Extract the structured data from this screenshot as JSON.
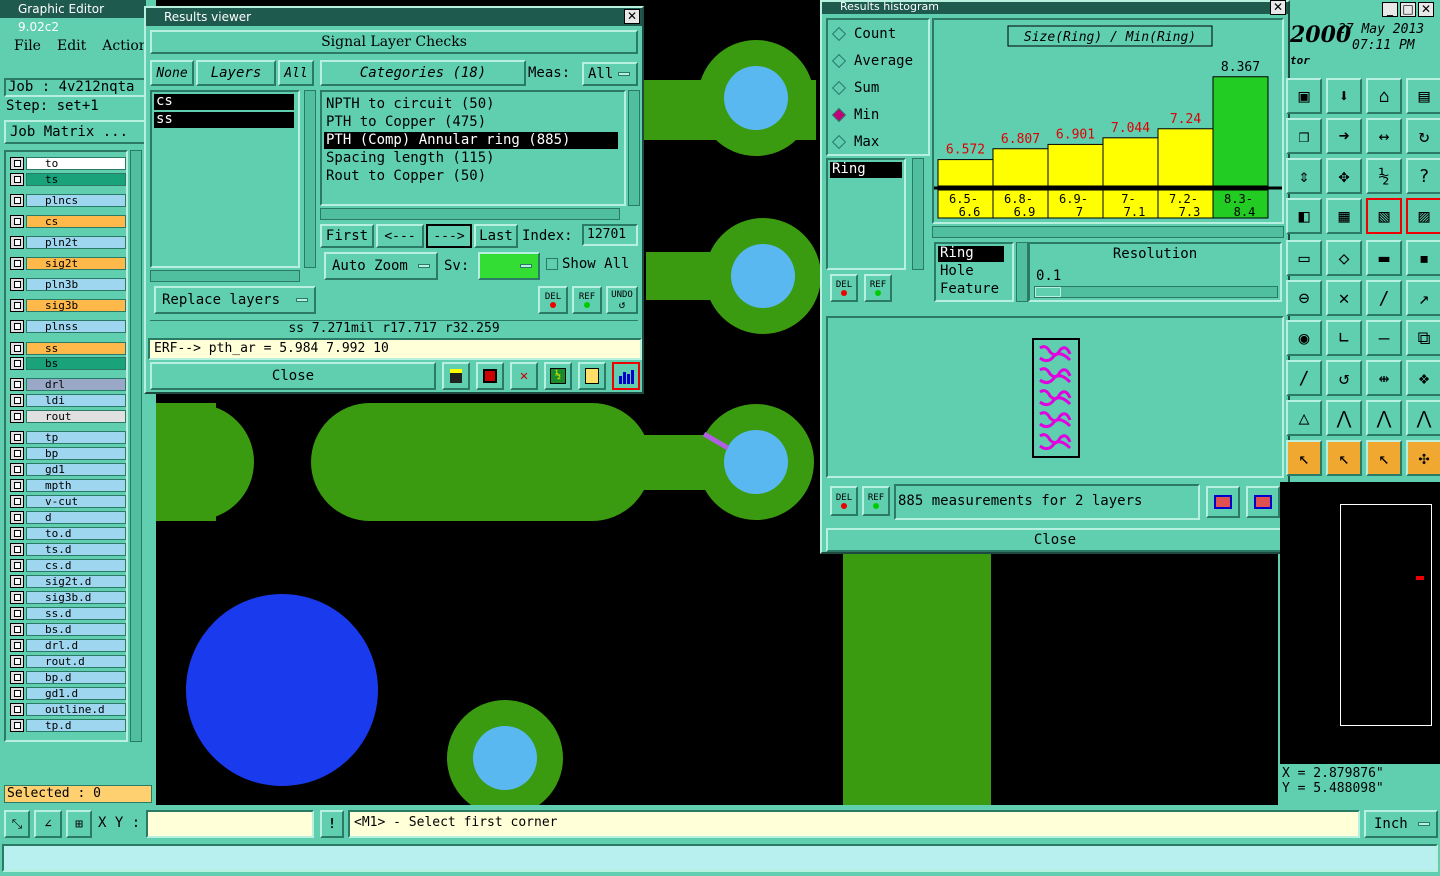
{
  "app": {
    "title": "Graphic Editor 9.02c2"
  },
  "menu": [
    "File",
    "Edit",
    "Actions"
  ],
  "job": {
    "label": "Job : 4v212nqta",
    "step": "Step: set+1",
    "matrix_button": "Job Matrix ..."
  },
  "layers": [
    {
      "name": "to",
      "color": "#ffffff"
    },
    {
      "name": "ts",
      "color": "#1aa37a"
    },
    {
      "name": "plncs",
      "color": "#9ed6f0"
    },
    {
      "name": "cs",
      "color": "#ffb84a"
    },
    {
      "name": "pln2t",
      "color": "#9ed6f0"
    },
    {
      "name": "sig2t",
      "color": "#ffb84a"
    },
    {
      "name": "pln3b",
      "color": "#9ed6f0"
    },
    {
      "name": "sig3b",
      "color": "#ffb84a"
    },
    {
      "name": "plnss",
      "color": "#9ed6f0"
    },
    {
      "name": "ss",
      "color": "#ffb84a"
    },
    {
      "name": "bs",
      "color": "#1aa37a"
    },
    {
      "name": "drl",
      "color": "#9aa8c8"
    },
    {
      "name": "ldi",
      "color": "#9ed6f0"
    },
    {
      "name": "rout",
      "color": "#e0e0e0"
    },
    {
      "name": "tp",
      "color": "#9ed6f0"
    },
    {
      "name": "bp",
      "color": "#9ed6f0"
    },
    {
      "name": "gd1",
      "color": "#9ed6f0"
    },
    {
      "name": "mpth",
      "color": "#9ed6f0"
    },
    {
      "name": "v-cut",
      "color": "#9ed6f0"
    },
    {
      "name": "d",
      "color": "#9ed6f0"
    },
    {
      "name": "to.d",
      "color": "#9ed6f0"
    },
    {
      "name": "ts.d",
      "color": "#9ed6f0"
    },
    {
      "name": "cs.d",
      "color": "#9ed6f0"
    },
    {
      "name": "sig2t.d",
      "color": "#9ed6f0"
    },
    {
      "name": "sig3b.d",
      "color": "#9ed6f0"
    },
    {
      "name": "ss.d",
      "color": "#9ed6f0"
    },
    {
      "name": "bs.d",
      "color": "#9ed6f0"
    },
    {
      "name": "drl.d",
      "color": "#9ed6f0"
    },
    {
      "name": "rout.d",
      "color": "#9ed6f0"
    },
    {
      "name": "bp.d",
      "color": "#9ed6f0"
    },
    {
      "name": "gd1.d",
      "color": "#9ed6f0"
    },
    {
      "name": "outline.d",
      "color": "#9ed6f0"
    },
    {
      "name": "tp.d",
      "color": "#9ed6f0"
    }
  ],
  "selected": "Selected : 0",
  "results_viewer": {
    "title": "Results viewer",
    "header": "Signal Layer Checks",
    "none": "None",
    "layers": "Layers",
    "all": "All",
    "categories": "Categories (18)",
    "meas_label": "Meas:",
    "meas_value": "All",
    "layer_list": [
      "cs",
      "ss"
    ],
    "category_list": [
      "NPTH to circuit (50)",
      "PTH to Copper (475)",
      "PTH (Comp) Annular ring (885)",
      "Spacing length (115)",
      "Rout to Copper (50)"
    ],
    "first": "First",
    "prev": "<---",
    "next": "--->",
    "last": "Last",
    "index_label": "Index:",
    "index_value": "12701",
    "auto_zoom": "Auto Zoom",
    "sv_label": "Sv:",
    "show_all": "Show All",
    "replace_layers": "Replace layers",
    "del": "DEL",
    "ref": "REF",
    "undo": "UNDO",
    "status": "ss 7.271mil  r17.717  r32.259",
    "erf": "ERF--> pth_ar = 5.984 7.992 10",
    "close": "Close"
  },
  "histogram": {
    "title": "Results histogram",
    "options": [
      "Count",
      "Average",
      "Sum",
      "Min",
      "Max"
    ],
    "selected_option": "Min",
    "list_item": "Ring",
    "chart_title": "Size(Ring) / Min(Ring)",
    "resolution_label": "Resolution",
    "resolution_value": "0.1",
    "attr_list": [
      "Ring",
      "Hole",
      "Feature"
    ],
    "measurements": "885 measurements for 2 layers",
    "del": "DEL",
    "ref": "REF",
    "close": "Close"
  },
  "chart_data": {
    "type": "bar",
    "title": "Size(Ring) / Min(Ring)",
    "categories": [
      "6.5-6.6",
      "6.8-6.9",
      "6.9-7",
      "7-7.1",
      "7.2-7.3",
      "8.3-8.4"
    ],
    "values": [
      6.572,
      6.807,
      6.901,
      7.044,
      7.24,
      8.367
    ],
    "value_labels": [
      "6.572",
      "6.807",
      "6.901",
      "7.044",
      "7.24",
      "8.367"
    ],
    "category_lines": [
      [
        "6.5-",
        "6.6"
      ],
      [
        "6.8-",
        "6.9"
      ],
      [
        "6.9-",
        "7"
      ],
      [
        "7-",
        "7.1"
      ],
      [
        "7.2-",
        "7.3"
      ],
      [
        "8.3-",
        "8.4"
      ]
    ],
    "highlight_index": 5,
    "colors": {
      "bar": "#ffff00",
      "highlight": "#22cc22",
      "label": "#e00000",
      "highlight_label": "#000000"
    }
  },
  "clock": {
    "year": "2000",
    "date": "27 May 2013",
    "time": "07:11 PM",
    "sub": "tor"
  },
  "coords": {
    "x": "X = 2.879876\"",
    "y": "Y = 5.488098\""
  },
  "bottom": {
    "xy_label": "X Y :",
    "prompt": "<M1> - Select first corner",
    "units": "Inch"
  }
}
